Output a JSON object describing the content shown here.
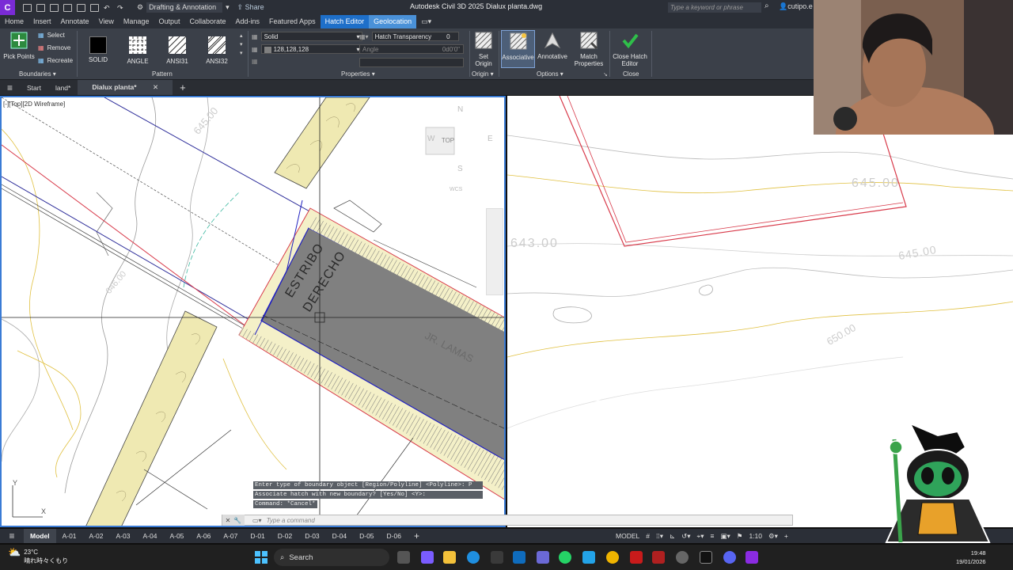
{
  "titlebar": {
    "logo": "C",
    "workspace": "Drafting & Annotation",
    "share": "Share",
    "app_title": "Autodesk Civil 3D 2025   Dialux planta.dwg",
    "search_placeholder": "Type a keyword or phrase",
    "user": "cutipo.e"
  },
  "menu_tabs": [
    "Home",
    "Insert",
    "Annotate",
    "View",
    "Manage",
    "Output",
    "Collaborate",
    "Add-ins",
    "Featured Apps",
    "Hatch Editor",
    "Geolocation"
  ],
  "ribbon": {
    "boundaries": {
      "pick_points": "Pick Points",
      "select": "Select",
      "remove": "Remove",
      "recreate": "Recreate",
      "title": "Boundaries"
    },
    "pattern": {
      "items": [
        "SOLID",
        "ANGLE",
        "ANSI31",
        "ANSI32"
      ],
      "title": "Pattern"
    },
    "properties": {
      "hatch_type": "Solid",
      "color": "128,128,128",
      "transparency_label": "Hatch Transparency",
      "transparency_value": "0",
      "angle_label": "Angle",
      "angle_value": "0d0'0\"",
      "title": "Properties"
    },
    "origin": {
      "set_origin": "Set Origin",
      "title": "Origin"
    },
    "options": {
      "associative": "Associative",
      "annotative": "Annotative",
      "match_properties": "Match Properties",
      "title": "Options"
    },
    "close": {
      "label": "Close Hatch Editor",
      "title": "Close"
    }
  },
  "file_tabs": [
    "Start",
    "land*",
    "Dialux planta*"
  ],
  "viewport": {
    "info": "[-][Top][2D Wireframe]",
    "viewcube": {
      "n": "N",
      "s": "S",
      "e": "E",
      "w": "W",
      "top": "TOP",
      "wcs": "WCS"
    },
    "labels": {
      "estribo_1": "ESTRIBO",
      "estribo_2": "DERECHO",
      "jr_lamas": "JR. LAMAS",
      "contour_left_1": "645.00",
      "contour_left_2": "646.00",
      "contour_right_1": "645.00",
      "contour_right_2": "643.00",
      "contour_right_3": "645.00",
      "contour_right_4": "650.00",
      "ucs_y": "Y",
      "ucs_x": "X"
    }
  },
  "command": {
    "lines": [
      "Enter type of boundary object [Region/Polyline] <Polyline>: P",
      "Associate hatch with new boundary? [Yes/No] <Y>:",
      "Command: *Cancel*"
    ],
    "placeholder": "Type a command"
  },
  "layout_tabs": [
    "Model",
    "A-01",
    "A-02",
    "A-03",
    "A-04",
    "A-05",
    "A-06",
    "A-07",
    "D-01",
    "D-02",
    "D-03",
    "D-04",
    "D-05",
    "D-06"
  ],
  "status": {
    "model": "MODEL",
    "scale": "1:10"
  },
  "taskbar": {
    "temp": "23°C",
    "weather": "晴れ時々くもり",
    "search": "Search",
    "time": "19:48",
    "date": "19/01/2026"
  },
  "colors": {
    "ribbon_bg": "#3b4049",
    "accent": "#1e6fc9",
    "hatch_gray": "#808080"
  }
}
